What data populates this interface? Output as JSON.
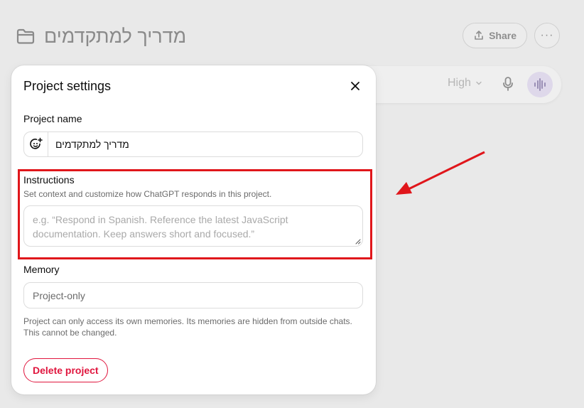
{
  "page": {
    "project_title": "מדריך למתקדמים",
    "share_label": "Share",
    "more_label": "···",
    "model_select": "High"
  },
  "modal": {
    "title": "Project settings",
    "project_name_label": "Project name",
    "project_name_value": "מדריך למתקדמים",
    "instructions_label": "Instructions",
    "instructions_help": "Set context and customize how ChatGPT responds in this project.",
    "instructions_placeholder": "e.g. “Respond in Spanish. Reference the latest JavaScript documentation. Keep answers short and focused.”",
    "memory_label": "Memory",
    "memory_value": "Project-only",
    "memory_help": "Project can only access its own memories. Its memories are hidden from outside chats. This cannot be changed.",
    "delete_label": "Delete project"
  },
  "colors": {
    "annotation": "#e0161b",
    "danger": "#e0163e"
  },
  "icons": {
    "folder": "folder-icon",
    "share": "share-icon",
    "close": "close-icon",
    "emoji": "emoji-picker-icon",
    "mic": "microphone-icon",
    "voice": "voice-mode-icon",
    "chevron": "chevron-down-icon"
  }
}
